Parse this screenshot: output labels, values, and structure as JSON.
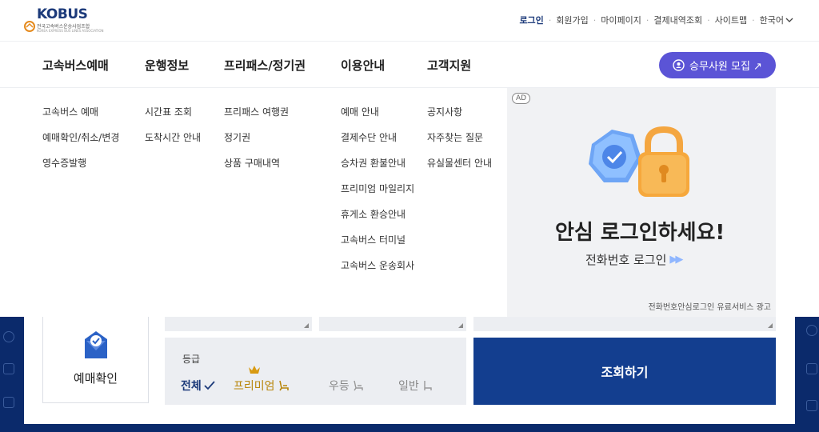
{
  "logo": {
    "brand": "KOBUS",
    "subtitle": "전국고속버스운송사업조합",
    "subtitle2": "KOREA EXPRESS BUS LINES ASSOCIATION"
  },
  "util_nav": {
    "items": [
      "로그인",
      "회원가입",
      "마이페이지",
      "결제내역조회",
      "사이트맵",
      "한국어"
    ]
  },
  "main_nav": {
    "items": [
      "고속버스예매",
      "운행정보",
      "프리패스/정기권",
      "이용안내",
      "고객지원"
    ],
    "recruit_label": "승무사원 모집 ↗"
  },
  "dropdown": {
    "col1": [
      "고속버스 예매",
      "예매확인/취소/변경",
      "영수증발행"
    ],
    "col2": [
      "시간표 조회",
      "도착시간 안내"
    ],
    "col3": [
      "프리패스 여행권",
      "정기권",
      "상품 구매내역"
    ],
    "col4": [
      "예매 안내",
      "결제수단 안내",
      "승차권 환불안내",
      "프리미엄 마일리지",
      "휴게소 환승안내",
      "고속버스 터미널",
      "고속버스 운송회사"
    ],
    "col5": [
      "공지사항",
      "자주찾는 질문",
      "유실물센터 안내"
    ]
  },
  "ad": {
    "badge": "AD",
    "title": "안심 로그인하세요!",
    "subtitle": "전화번호 로그인",
    "footer": "전화번호안심로그인 유료서비스 광고"
  },
  "booking": {
    "reservation_check_label": "예매확인",
    "grade_label": "등급",
    "grade_options": [
      "전체",
      "프리미엄",
      "우등",
      "일반"
    ],
    "search_label": "조회하기"
  },
  "colors": {
    "brand_navy": "#1c3a7a",
    "accent_purple": "#5b54d6",
    "search_blue": "#133e8f",
    "premium_gold": "#b8860b"
  }
}
